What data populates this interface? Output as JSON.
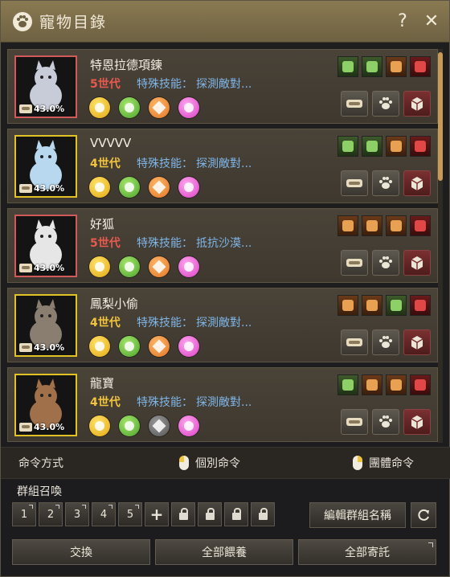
{
  "window": {
    "title": "寵物目錄",
    "help_icon": "question-mark-icon",
    "close_icon": "close-icon"
  },
  "pets": [
    {
      "name": "特恩拉德項鍊",
      "generation": "5世代",
      "gen_color": "red",
      "skill_label": "特殊技能：",
      "skill_value": "探測敵對...",
      "hunger": "43.0%",
      "frame": "red",
      "tiers": [
        "yellow",
        "green",
        "orange",
        "pink"
      ],
      "skills": [
        "green",
        "green",
        "orange",
        "red"
      ]
    },
    {
      "name": "VVVVV",
      "generation": "4世代",
      "gen_color": "gold",
      "skill_label": "特殊技能：",
      "skill_value": "探測敵對...",
      "hunger": "43.0%",
      "frame": "gold",
      "tiers": [
        "yellow",
        "green",
        "orange",
        "pink"
      ],
      "skills": [
        "green",
        "green",
        "orange",
        "red"
      ]
    },
    {
      "name": "好狐",
      "generation": "5世代",
      "gen_color": "red",
      "skill_label": "特殊技能：",
      "skill_value": "抵抗沙漠...",
      "hunger": "43.0%",
      "frame": "red",
      "tiers": [
        "yellow",
        "green",
        "orange",
        "pink"
      ],
      "skills": [
        "orange",
        "orange",
        "orange",
        "red"
      ]
    },
    {
      "name": "鳳梨小偷",
      "generation": "4世代",
      "gen_color": "gold",
      "skill_label": "特殊技能：",
      "skill_value": "探測敵對...",
      "hunger": "43.0%",
      "frame": "gold",
      "tiers": [
        "yellow",
        "green",
        "orange",
        "pink"
      ],
      "skills": [
        "orange",
        "orange",
        "green",
        "red"
      ]
    },
    {
      "name": "龍寶",
      "generation": "4世代",
      "gen_color": "gold",
      "skill_label": "特殊技能：",
      "skill_value": "探測敵對...",
      "hunger": "43.0%",
      "frame": "gold",
      "tiers": [
        "yellow",
        "green",
        "gray",
        "pink"
      ],
      "skills": [
        "green",
        "orange",
        "orange",
        "red"
      ]
    }
  ],
  "command": {
    "label": "命令方式",
    "individual": "個別命令",
    "group": "團體命令"
  },
  "group_summon": {
    "label": "群組召喚",
    "slots": [
      "1",
      "2",
      "3",
      "4",
      "5"
    ],
    "edit_label": "編輯群組名稱"
  },
  "bottom": {
    "exchange": "交換",
    "feed_all": "全部餵養",
    "store_all": "全部寄託"
  },
  "colors": {
    "gen_red": "#e85a4f",
    "gen_gold": "#f2c43d",
    "skill_blue": "#7fb6e8",
    "title_bar": "#8a7a52"
  }
}
